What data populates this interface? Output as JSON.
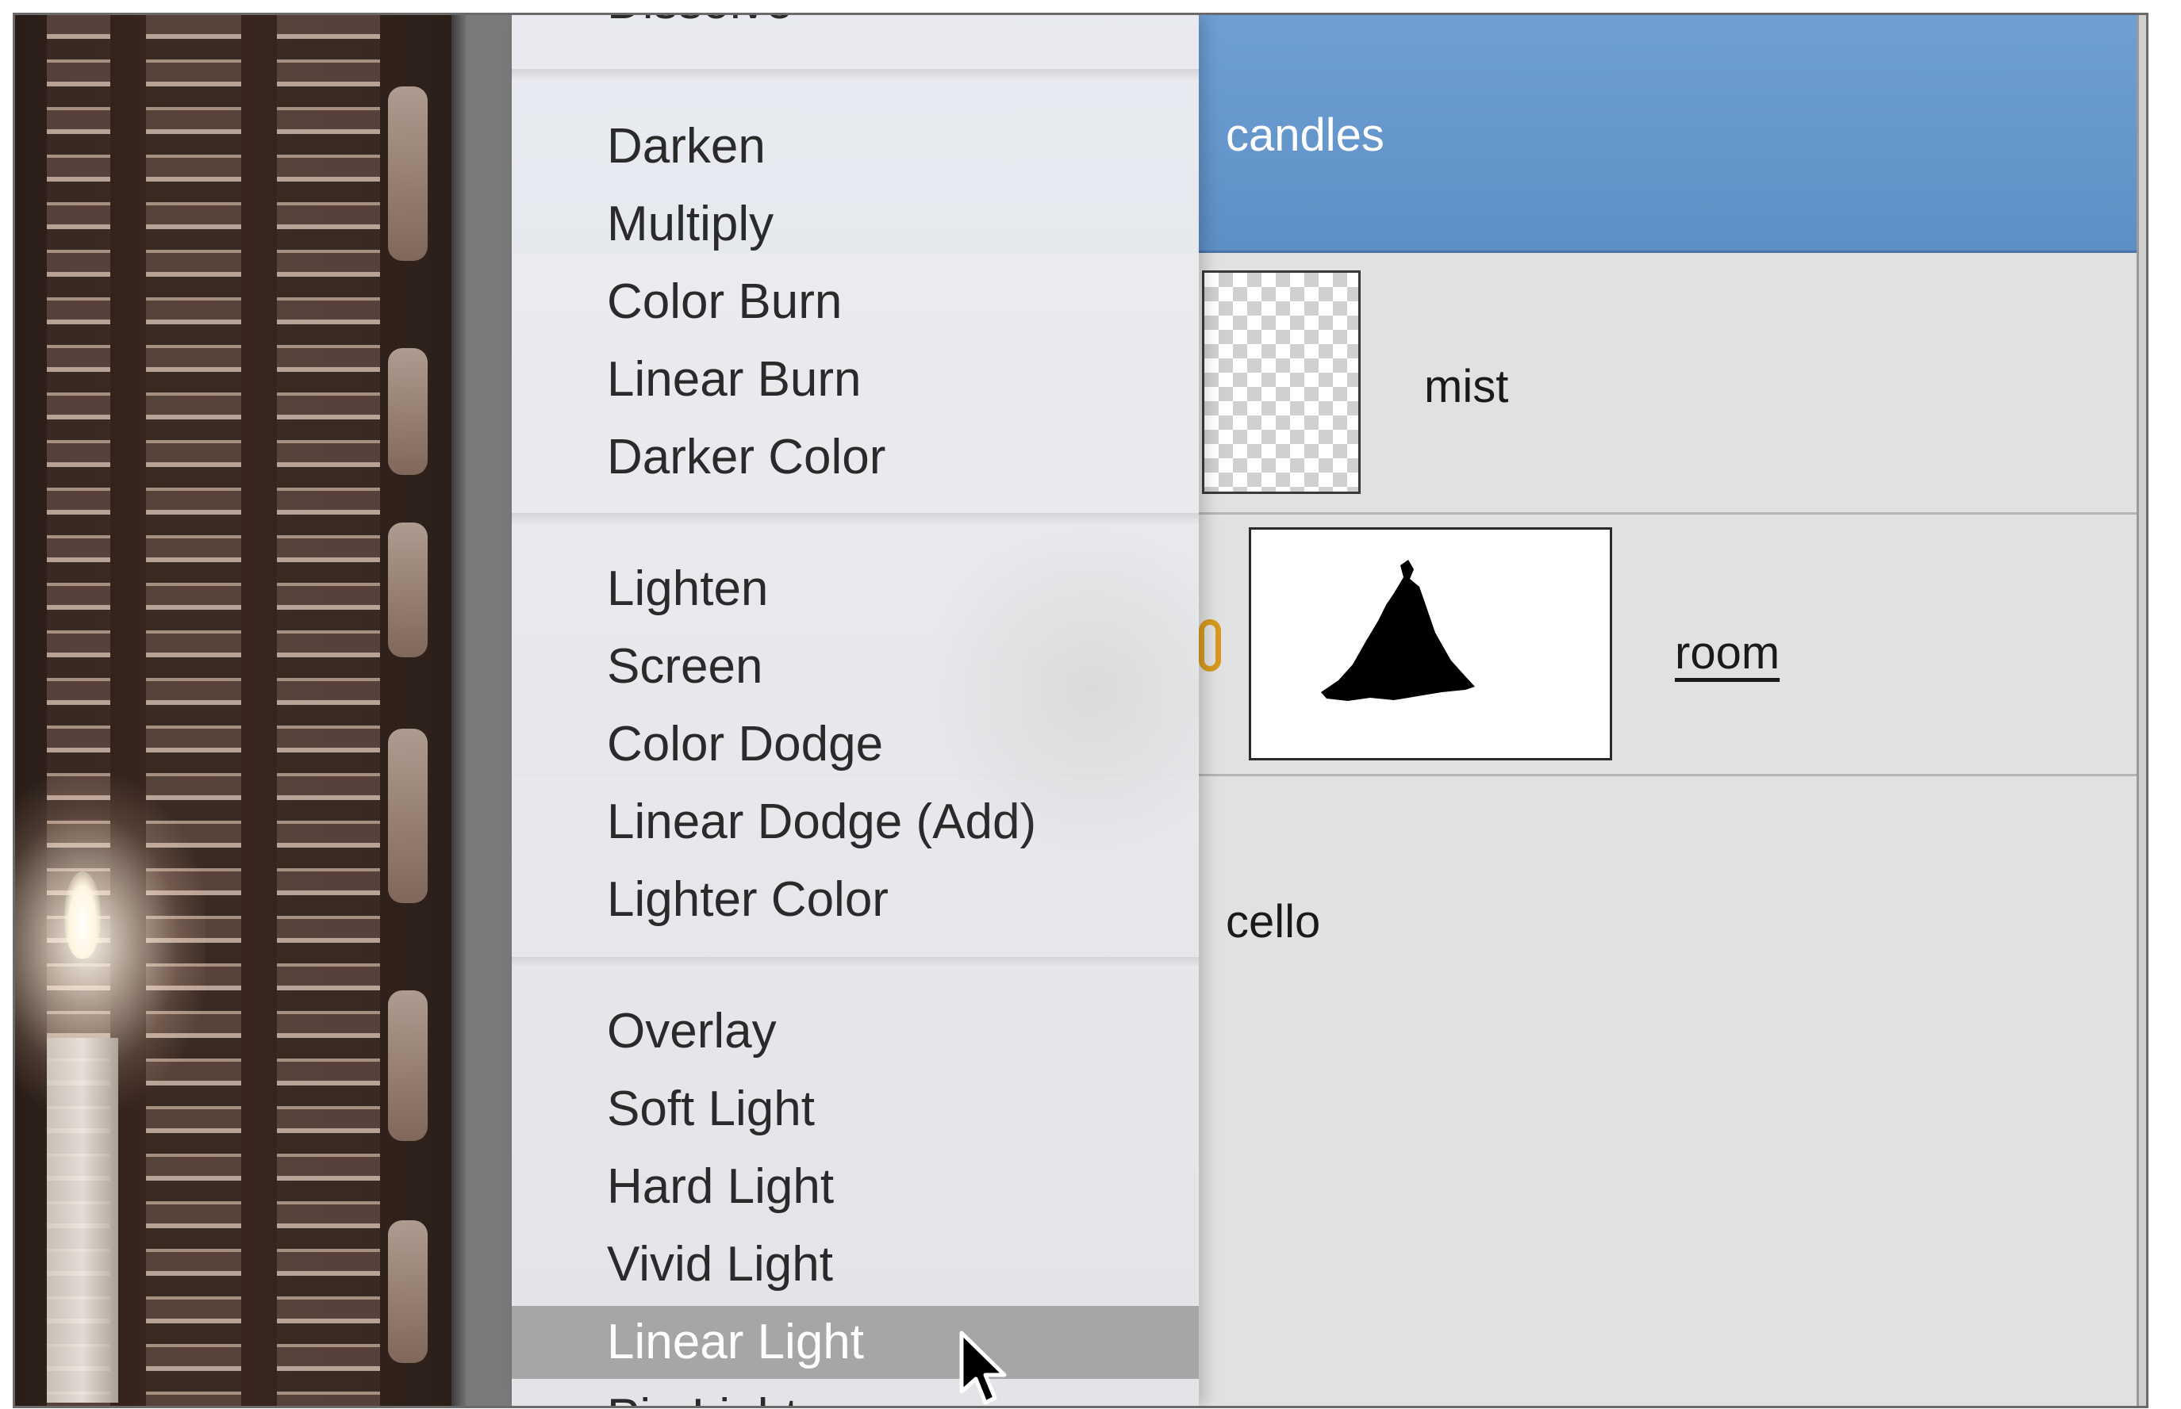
{
  "colors": {
    "selected_layer": "#6a9bd0",
    "menu_highlight": "#a6a6a6",
    "link_icon": "#d79a1f",
    "panel_bg": "#e1e1e1"
  },
  "blend_menu": {
    "partial_top_item": "Dissolve",
    "groups": [
      [
        "Darken",
        "Multiply",
        "Color Burn",
        "Linear Burn",
        "Darker Color"
      ],
      [
        "Lighten",
        "Screen",
        "Color Dodge",
        "Linear Dodge (Add)",
        "Lighter Color"
      ],
      [
        "Overlay",
        "Soft Light",
        "Hard Light",
        "Vivid Light",
        "Linear Light"
      ]
    ],
    "highlighted_item": "Linear Light",
    "partial_bottom_item": "Pin Light"
  },
  "layers": [
    {
      "name": "candles",
      "selected": true
    },
    {
      "name": "mist",
      "thumbnail": "transparency-checkerboard"
    },
    {
      "name": "room",
      "thumbnail": "layer-mask",
      "linked": true
    },
    {
      "name": "cello"
    }
  ],
  "icons": {
    "link": "link-icon",
    "cursor": "arrow-cursor-icon"
  }
}
